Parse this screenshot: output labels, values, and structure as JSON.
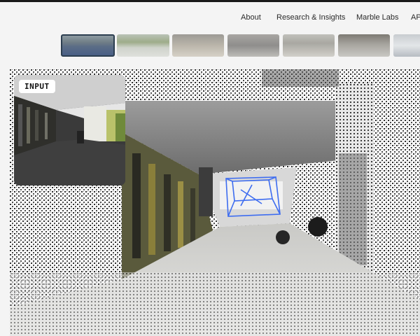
{
  "nav": {
    "items": [
      "About",
      "Research & Insights",
      "Marble Labs",
      "AP"
    ]
  },
  "thumbnails": {
    "count": 7,
    "selected_index": 0
  },
  "viewer": {
    "input_label": "INPUT",
    "box_color": "#3d6cf0",
    "icons": [
      "point-cloud-scene",
      "bounding-box"
    ]
  },
  "colors": {
    "page_bg": "#f4f4f4",
    "top_bar": "#1a1a1a",
    "nav_text": "#2a2a2a",
    "badge_bg": "#ffffff",
    "badge_text": "#111111"
  }
}
